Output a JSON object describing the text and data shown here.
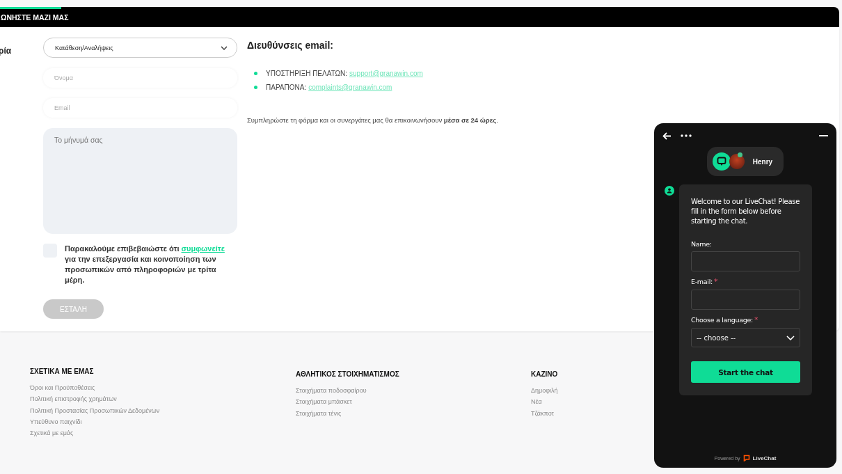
{
  "header": {
    "title": "ΩΝΗΣΤΕ ΜΑΖΙ ΜΑΣ"
  },
  "form": {
    "category_label": "ρία",
    "category_value": "Κατάθεση/Αναλήψεις",
    "name_placeholder": "Όνομα",
    "email_placeholder": "Email",
    "message_placeholder": "Το μήνυμά σας",
    "consent_checked": false,
    "consent_text": "Παρακαλούμε επιβεβαιώστε ότι",
    "consent_link": "συμφωνείτε",
    "consent_rest": "για την επεξεργασία και κοινοποίηση των προσωπικών από πληροφοριών με τρίτα μέρη.",
    "submit": "ΕΣΤΑΛΗ",
    "submit_disabled": true
  },
  "emails": {
    "title": "Διευθύνσεις email:",
    "items": [
      {
        "label": "ΥΠΟΣΤΗΡΙΞΗ ΠΕΛΑΤΩΝ:",
        "address": "support@granawin.com"
      },
      {
        "label": "ΠΑΡΑΠΟΝΑ:",
        "address": "complaints@granawin.com"
      }
    ],
    "note": "Συμπληρώστε τη φόρμα και οι συνεργάτες μας θα επικοινωνήσουν **μέσα σε 24 ώρες**."
  },
  "footer": {
    "columns": [
      {
        "title": "ΣΧΕΤΙΚΑ ΜΕ ΕΜΑΣ",
        "links": [
          "Όροι και Προϋποθέσεις",
          "Πολιτική επιστροφής χρημάτων",
          "Πολιτική Προστασίας Προσωπικών Δεδομένων",
          "Υπεύθυνο παιχνίδι",
          "Σχετικά με εμάς"
        ]
      },
      {
        "title": "ΑΘΛΗΤΙΚΟΣ ΣΤΟΙΧΗΜΑΤΙΣΜΟΣ",
        "links": [
          "Στοιχήματα ποδοσφαίρου",
          "Στοιχήματα μπάσκετ",
          "Στοιχήματα τένις"
        ]
      },
      {
        "title": "ΚΑΖΙΝΟ",
        "links": [
          "Δημοφιλή",
          "Νέα",
          "Τζάκποτ"
        ]
      }
    ]
  },
  "chat": {
    "agent": "Henry",
    "agent_online": true,
    "welcome": "Welcome to our LiveChat! Please fill in the form below before starting the chat.",
    "fields": [
      {
        "kind": "text",
        "label": "Name:",
        "required": false
      },
      {
        "kind": "text",
        "label": "E-mail:",
        "required": true
      },
      {
        "kind": "select",
        "label": "Choose a language:",
        "required": true,
        "value": "-- choose --"
      }
    ],
    "required_mark": "*",
    "start": "Start the chat",
    "powered_by": "Powered by",
    "brand": "LiveChat"
  }
}
